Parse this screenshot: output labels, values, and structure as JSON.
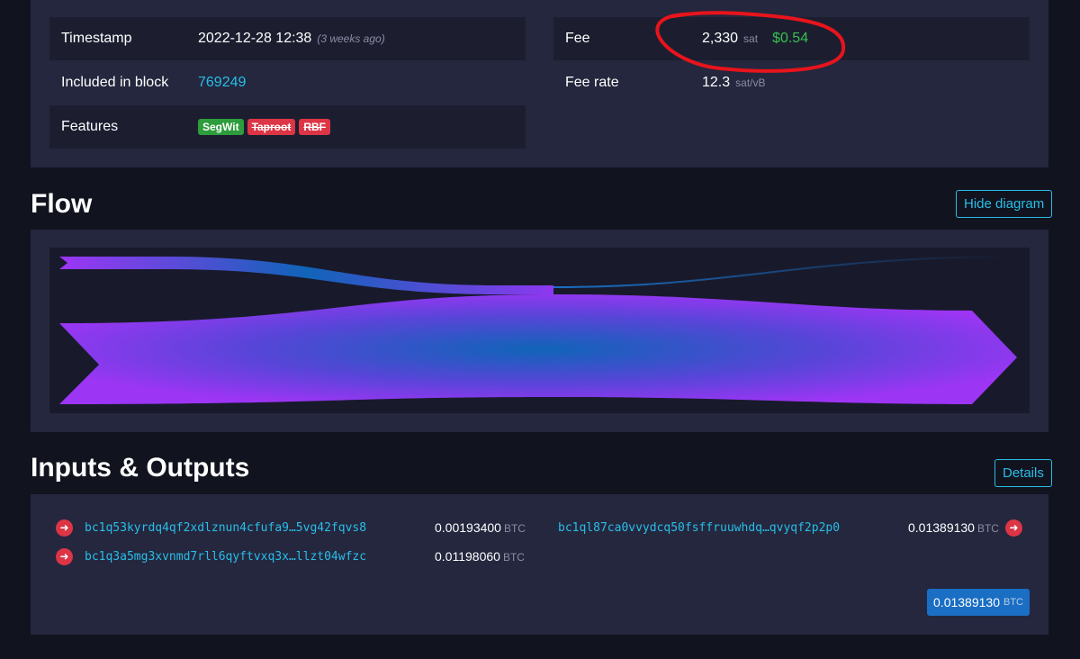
{
  "details": {
    "timestamp_label": "Timestamp",
    "timestamp_value": "2022-12-28 12:38",
    "timestamp_relative": "(3 weeks ago)",
    "block_label": "Included in block",
    "block_value": "769249",
    "features_label": "Features",
    "features": [
      "SegWit",
      "Taproot",
      "RBF"
    ],
    "fee_label": "Fee",
    "fee_value": "2,330",
    "fee_unit": "sat",
    "fee_usd": "$0.54",
    "fee_rate_label": "Fee rate",
    "fee_rate_value": "12.3",
    "fee_rate_unit": "sat/vB"
  },
  "flow": {
    "title": "Flow",
    "hide_button": "Hide diagram"
  },
  "io": {
    "title": "Inputs & Outputs",
    "details_button": "Details",
    "btc_unit": "BTC",
    "inputs": [
      {
        "address": "bc1q53kyrdq4qf2xdlznun4cfufa9…5vg42fqvs8",
        "amount": "0.00193400"
      },
      {
        "address": "bc1q3a5mg3xvnmd7rll6qyftvxq3x…llzt04wfzc",
        "amount": "0.01198060"
      }
    ],
    "outputs": [
      {
        "address": "bc1ql87ca0vvydcq50fsffruuwhdq…qvyqf2p2p0",
        "amount": "0.01389130"
      }
    ],
    "total": "0.01389130"
  },
  "colors": {
    "accent": "#29bee8",
    "flow_purple": "#9d35f5",
    "flow_blue": "#1064b8",
    "annotation_red": "#e8141c",
    "fee_green": "#36c04f"
  }
}
